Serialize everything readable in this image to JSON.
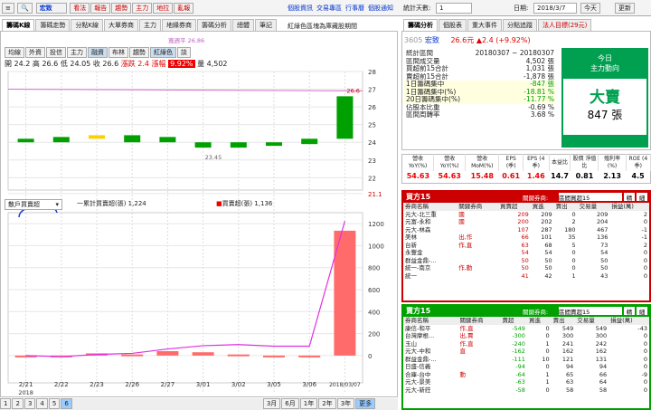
{
  "top": {
    "menu_icon": "≡",
    "zoom_icon": "🔍",
    "stock": "宏致",
    "buttons": [
      "看法",
      "報告",
      "趨勢",
      "主力",
      "地拉",
      "亂報"
    ],
    "links": [
      "個股資訊",
      "交易專區",
      "行事曆",
      "個股通知"
    ],
    "date_label": "日期:",
    "date": "2018/3/7",
    "today": "今天",
    "refresh": "更新",
    "stat_label": "統計天數:",
    "stat_days": "1"
  },
  "left_tabs": [
    "籌碼K線",
    "籌碼走勢",
    "分點K線",
    "大單券商",
    "主力",
    "地緣券商",
    "籌碼分析",
    "總體",
    "筆記"
  ],
  "legend_note": "紅綠色區塊為庫藏股期間",
  "sub_tabs": [
    "均線",
    "外資",
    "投信",
    "主力",
    "融資",
    "布林",
    "趨勢",
    "紅綠色",
    "談"
  ],
  "ma_label": "寬週平 26.86",
  "ohlc": {
    "open_l": "開",
    "open": "24.2",
    "high_l": "高",
    "high": "26.6",
    "low_l": "低",
    "low": "24.05",
    "close_l": "收",
    "close": "26.6",
    "chg_l": "漲跌",
    "chg": "2.4",
    "pct_l": "漲幅",
    "pct": "9.92%",
    "vol_l": "量",
    "vol": "4,502"
  },
  "price_axis": [
    "28",
    "27",
    "26",
    "25",
    "24",
    "23",
    "22",
    "21.1"
  ],
  "low_tag": "23.45",
  "high_tag": "26.6",
  "vol_select": "散戶買賣超",
  "vol_legend1": "一累計買賣超(張) 1,224",
  "vol_legend2": "買賣超(張) 1,136",
  "vol_axis": [
    "1200",
    "1000",
    "800",
    "600",
    "400",
    "200",
    "0"
  ],
  "x_dates": [
    "2/21",
    "2/22",
    "2/23",
    "2/26",
    "2/27",
    "3/01",
    "3/02",
    "3/05",
    "3/06",
    "2018/03/07"
  ],
  "x_year": "2018",
  "bottom_bar": {
    "pages": [
      "1",
      "2",
      "3",
      "4",
      "5",
      "6"
    ],
    "ranges": [
      "3月",
      "6月",
      "1年",
      "2年",
      "3年",
      "更多"
    ]
  },
  "chart_data": [
    {
      "type": "candlestick",
      "title": "",
      "x": [
        "2/21",
        "2/22",
        "2/23",
        "2/26",
        "2/27",
        "3/01",
        "3/02",
        "3/05",
        "3/06",
        "3/07"
      ],
      "open": [
        24.2,
        24.3,
        24.4,
        24.4,
        24.3,
        24.0,
        24.0,
        24.0,
        24.2,
        26.6
      ],
      "close": [
        24.0,
        24.0,
        24.2,
        24.0,
        24.0,
        23.7,
        23.7,
        23.8,
        23.9,
        24.2
      ],
      "ylim": [
        21.1,
        28
      ]
    },
    {
      "type": "bar",
      "title": "",
      "x": [
        "2/21",
        "2/22",
        "2/23",
        "2/26",
        "2/27",
        "3/01",
        "3/02",
        "3/05",
        "3/06",
        "3/07"
      ],
      "values": [
        0,
        -10,
        20,
        10,
        40,
        30,
        10,
        -15,
        0,
        1136
      ],
      "cumulative": [
        0,
        -10,
        10,
        20,
        60,
        90,
        100,
        85,
        85,
        1224
      ],
      "ylim": [
        -100,
        1300
      ]
    }
  ],
  "right_tabs": [
    "籌碼分析",
    "個股表",
    "重大事件",
    "分點追蹤",
    "法人目標(29元)"
  ],
  "quote": {
    "code": "3605",
    "name": "宏致",
    "price": "26.6元",
    "chg": "▲2.4 (+9.92%)"
  },
  "stats": [
    {
      "k": "統計區間",
      "v": "20180307 ~ 20180307"
    },
    {
      "k": "區間成交量",
      "v": "4,502 張"
    },
    {
      "k": "買超前15合計",
      "v": "1,031 張"
    },
    {
      "k": "賣超前15合計",
      "v": "-1,878 張"
    },
    {
      "k": "1日籌碼集中",
      "v": "-847 張"
    },
    {
      "k": "1日籌碼集中(%)",
      "v": "-18.81 %"
    },
    {
      "k": "20日籌碼集中(%)",
      "v": "-11.77 %"
    },
    {
      "k": "佔股本比重",
      "v": "-0.69 %"
    },
    {
      "k": "區間周轉率",
      "v": "3.68 %"
    }
  ],
  "today_box": {
    "t1": "今日",
    "t2": "主力動向",
    "big": "大賣",
    "num": "847 張"
  },
  "metrics": {
    "heads": [
      "營收 YoY(%)",
      "營收 YoY(%)",
      "營收 MoM(%)",
      "EPS (季)",
      "EPS (4季)",
      "本益比",
      "股價 淨值比",
      "殖利率 (%)",
      "ROE (4季)"
    ],
    "vals": [
      "54.63",
      "54.63",
      "15.48",
      "0.61",
      "1.46",
      "14.7",
      "0.81",
      "2.13",
      "4.5"
    ]
  },
  "buy": {
    "title": "買方15",
    "filter_label": "關鍵券商:",
    "filter": "區間買超15",
    "btn1": "精",
    "btn2": "細",
    "cols": [
      "券商名稱",
      "關鍵券商",
      "買賣超",
      "買進",
      "賣出",
      "交易量",
      "損益(萬)"
    ],
    "rows": [
      [
        "元大-北三重",
        "國",
        "209",
        "209",
        "0",
        "209",
        "2"
      ],
      [
        "元富-永和",
        "國",
        "200",
        "202",
        "2",
        "204",
        "0"
      ],
      [
        "元大-林森",
        "",
        "107",
        "287",
        "180",
        "467",
        "-1"
      ],
      [
        "美林",
        "出,作",
        "66",
        "101",
        "35",
        "136",
        "-1"
      ],
      [
        "台新",
        "作,直",
        "63",
        "68",
        "5",
        "73",
        "2"
      ],
      [
        "永豐金",
        "",
        "54",
        "54",
        "0",
        "54",
        "0"
      ],
      [
        "群益金鼎-...",
        "",
        "50",
        "50",
        "0",
        "50",
        "0"
      ],
      [
        "統一-南京",
        "作,動",
        "50",
        "50",
        "0",
        "50",
        "0"
      ],
      [
        "統一",
        "",
        "41",
        "42",
        "1",
        "43",
        "0"
      ]
    ]
  },
  "sell": {
    "title": "賣方15",
    "filter_label": "關鍵券商:",
    "filter": "區間賣超15",
    "btn1": "精",
    "btn2": "細",
    "cols": [
      "券商名稱",
      "關鍵券商",
      "賣超",
      "買進",
      "賣出",
      "交易量",
      "損益(萬)"
    ],
    "rows": [
      [
        "康信-和平",
        "作,直",
        "-549",
        "0",
        "549",
        "549",
        "-43"
      ],
      [
        "台灣摩根...",
        "出,賈",
        "-300",
        "0",
        "300",
        "300",
        "0"
      ],
      [
        "玉山",
        "作,直",
        "-240",
        "1",
        "241",
        "242",
        "0"
      ],
      [
        "元大-中和",
        "直",
        "-162",
        "0",
        "162",
        "162",
        "0"
      ],
      [
        "群益金鼎-...",
        "",
        "-111",
        "10",
        "121",
        "131",
        "0"
      ],
      [
        "日盛-信義",
        "",
        "-94",
        "0",
        "94",
        "94",
        "0"
      ],
      [
        "合庫-台中",
        "動",
        "-64",
        "1",
        "65",
        "66",
        "-9"
      ],
      [
        "元大-景美",
        "",
        "-63",
        "1",
        "63",
        "64",
        "0"
      ],
      [
        "元大-新莊",
        "",
        "-58",
        "0",
        "58",
        "58",
        "0"
      ]
    ]
  }
}
